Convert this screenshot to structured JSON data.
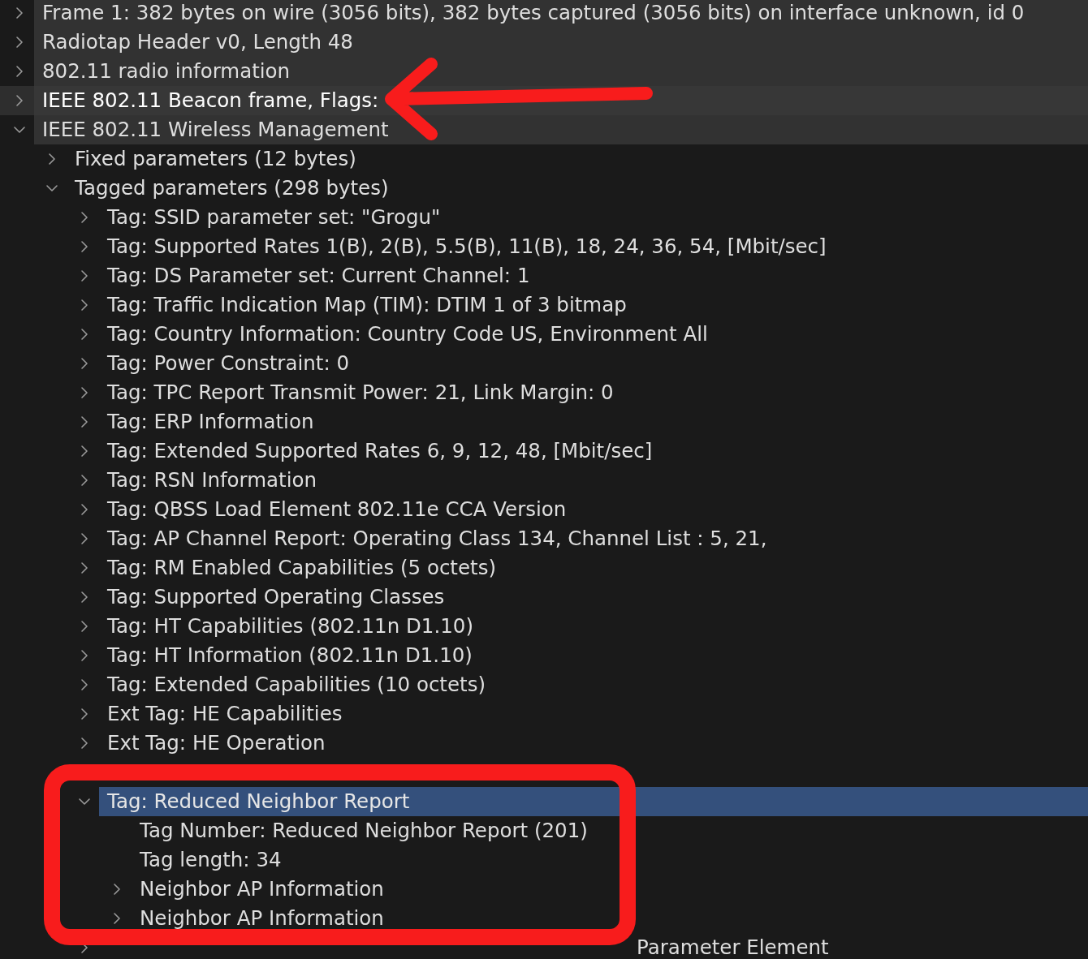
{
  "tree": [
    {
      "label": "Frame 1: 382 bytes on wire (3056 bits), 382 bytes captured (3056 bits) on interface unknown, id 0",
      "kind": "branch",
      "expanded": false,
      "selected": false,
      "hovered": false
    },
    {
      "label": "Radiotap Header v0, Length 48",
      "kind": "branch",
      "expanded": false,
      "selected": false,
      "hovered": false
    },
    {
      "label": "802.11 radio information",
      "kind": "branch",
      "expanded": false,
      "selected": false,
      "hovered": false
    },
    {
      "label": "IEEE 802.11 Beacon frame, Flags:",
      "kind": "branch",
      "expanded": false,
      "selected": false,
      "hovered": true
    },
    {
      "label": "IEEE 802.11 Wireless Management",
      "kind": "branch",
      "expanded": true,
      "selected": false,
      "hovered": false,
      "children": [
        {
          "label": "Fixed parameters (12 bytes)",
          "kind": "branch",
          "expanded": false,
          "selected": false,
          "hovered": false
        },
        {
          "label": "Tagged parameters (298 bytes)",
          "kind": "branch",
          "expanded": true,
          "selected": false,
          "hovered": false,
          "children": [
            {
              "label": "Tag: SSID parameter set: \"Grogu\"",
              "kind": "branch",
              "expanded": false,
              "selected": false,
              "hovered": false
            },
            {
              "label": "Tag: Supported Rates 1(B), 2(B), 5.5(B), 11(B), 18, 24, 36, 54, [Mbit/sec]",
              "kind": "branch",
              "expanded": false,
              "selected": false,
              "hovered": false
            },
            {
              "label": "Tag: DS Parameter set: Current Channel: 1",
              "kind": "branch",
              "expanded": false,
              "selected": false,
              "hovered": false
            },
            {
              "label": "Tag: Traffic Indication Map (TIM): DTIM 1 of 3 bitmap",
              "kind": "branch",
              "expanded": false,
              "selected": false,
              "hovered": false
            },
            {
              "label": "Tag: Country Information: Country Code US, Environment All",
              "kind": "branch",
              "expanded": false,
              "selected": false,
              "hovered": false
            },
            {
              "label": "Tag: Power Constraint: 0",
              "kind": "branch",
              "expanded": false,
              "selected": false,
              "hovered": false
            },
            {
              "label": "Tag: TPC Report Transmit Power: 21, Link Margin: 0",
              "kind": "branch",
              "expanded": false,
              "selected": false,
              "hovered": false
            },
            {
              "label": "Tag: ERP Information",
              "kind": "branch",
              "expanded": false,
              "selected": false,
              "hovered": false
            },
            {
              "label": "Tag: Extended Supported Rates 6, 9, 12, 48, [Mbit/sec]",
              "kind": "branch",
              "expanded": false,
              "selected": false,
              "hovered": false
            },
            {
              "label": "Tag: RSN Information",
              "kind": "branch",
              "expanded": false,
              "selected": false,
              "hovered": false
            },
            {
              "label": "Tag: QBSS Load Element 802.11e CCA Version",
              "kind": "branch",
              "expanded": false,
              "selected": false,
              "hovered": false
            },
            {
              "label": "Tag: AP Channel Report: Operating Class 134, Channel List : 5, 21,",
              "kind": "branch",
              "expanded": false,
              "selected": false,
              "hovered": false
            },
            {
              "label": "Tag: RM Enabled Capabilities (5 octets)",
              "kind": "branch",
              "expanded": false,
              "selected": false,
              "hovered": false
            },
            {
              "label": "Tag: Supported Operating Classes",
              "kind": "branch",
              "expanded": false,
              "selected": false,
              "hovered": false
            },
            {
              "label": "Tag: HT Capabilities (802.11n D1.10)",
              "kind": "branch",
              "expanded": false,
              "selected": false,
              "hovered": false
            },
            {
              "label": "Tag: HT Information (802.11n D1.10)",
              "kind": "branch",
              "expanded": false,
              "selected": false,
              "hovered": false
            },
            {
              "label": "Tag: Extended Capabilities (10 octets)",
              "kind": "branch",
              "expanded": false,
              "selected": false,
              "hovered": false
            },
            {
              "label": "Ext Tag: HE Capabilities",
              "kind": "branch",
              "expanded": false,
              "selected": false,
              "hovered": false
            },
            {
              "label": "Ext Tag: HE Operation",
              "kind": "branch",
              "expanded": false,
              "selected": false,
              "hovered": false
            },
            {
              "kind": "covered"
            },
            {
              "label": "Tag: Reduced Neighbor Report",
              "kind": "branch",
              "expanded": true,
              "selected": true,
              "hovered": false,
              "children": [
                {
                  "label": "Tag Number: Reduced Neighbor Report (201)",
                  "kind": "leaf",
                  "selected": false,
                  "hovered": false
                },
                {
                  "label": "Tag length: 34",
                  "kind": "leaf",
                  "selected": false,
                  "hovered": false
                },
                {
                  "label": "Neighbor AP Information",
                  "kind": "branch",
                  "expanded": false,
                  "selected": false,
                  "hovered": false
                },
                {
                  "label": "Neighbor AP Information",
                  "kind": "branch",
                  "expanded": false,
                  "selected": false,
                  "hovered": false
                }
              ]
            },
            {
              "label": "Parameter Element",
              "kind": "branch",
              "expanded": false,
              "selected": false,
              "hovered": false
            }
          ]
        }
      ]
    }
  ],
  "annotations": {
    "arrow": true,
    "frame": true
  }
}
